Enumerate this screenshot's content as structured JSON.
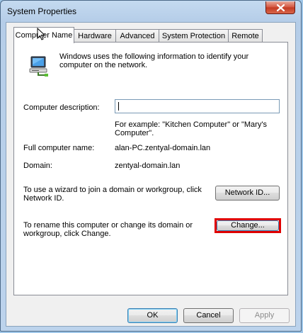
{
  "window": {
    "title": "System Properties"
  },
  "tabs": [
    {
      "label": "Computer Name",
      "active": true
    },
    {
      "label": "Hardware",
      "active": false
    },
    {
      "label": "Advanced",
      "active": false
    },
    {
      "label": "System Protection",
      "active": false
    },
    {
      "label": "Remote",
      "active": false
    }
  ],
  "panel": {
    "intro": "Windows uses the following information to identify your computer on the network.",
    "description_label": "Computer description:",
    "description_value": "",
    "description_example": "For example: \"Kitchen Computer\" or \"Mary's Computer\".",
    "full_name_label": "Full computer name:",
    "full_name_value": "alan-PC.zentyal-domain.lan",
    "domain_label": "Domain:",
    "domain_value": "zentyal-domain.lan",
    "network_id_text": "To use a wizard to join a domain or workgroup, click Network ID.",
    "network_id_button": "Network ID...",
    "rename_text": "To rename this computer or change its domain or workgroup, click Change.",
    "change_button": "Change..."
  },
  "footer": {
    "ok": "OK",
    "cancel": "Cancel",
    "apply": "Apply"
  },
  "colors": {
    "highlight": "#e00000",
    "close_button": "#c23a22"
  }
}
